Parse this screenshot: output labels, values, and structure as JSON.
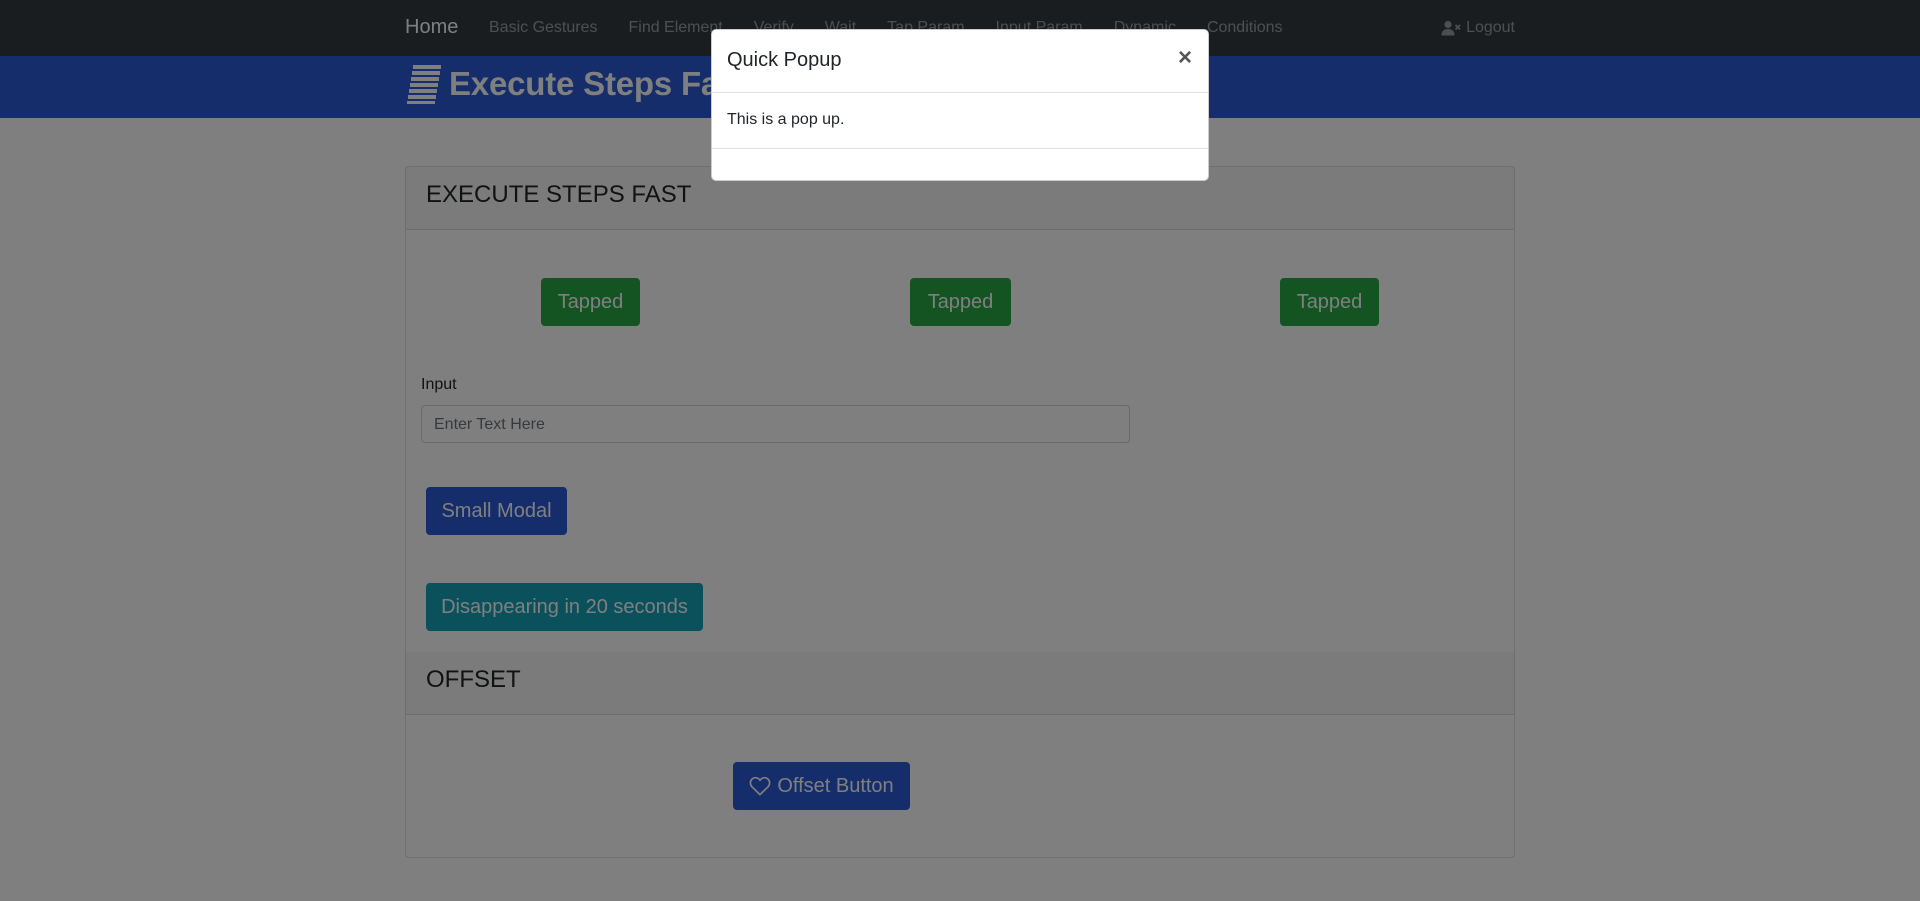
{
  "nav": {
    "brand": "Home",
    "links": [
      "Basic Gestures",
      "Find Element",
      "Verify",
      "Wait",
      "Tap Param",
      "Input Param",
      "Dynamic",
      "Conditions"
    ],
    "logout": "Logout"
  },
  "banner": {
    "title": "Execute Steps Fast"
  },
  "section1": {
    "header": "EXECUTE STEPS FAST",
    "tap_buttons": [
      "Tapped",
      "Tapped",
      "Tapped"
    ],
    "input_label": "Input",
    "input_placeholder": "Enter Text Here",
    "small_modal_button": "Small Modal",
    "disappearing_button": "Disappearing in 20 seconds"
  },
  "section2": {
    "header": "OFFSET",
    "offset_button": "Offset Button"
  },
  "modal": {
    "title": "Quick Popup",
    "close": "×",
    "body": "This is a pop up."
  },
  "colors": {
    "navbar": "#343a40",
    "banner": "#2a5bd7",
    "success": "#28a745",
    "primary": "#2a5bd7",
    "info": "#17a2b8"
  }
}
